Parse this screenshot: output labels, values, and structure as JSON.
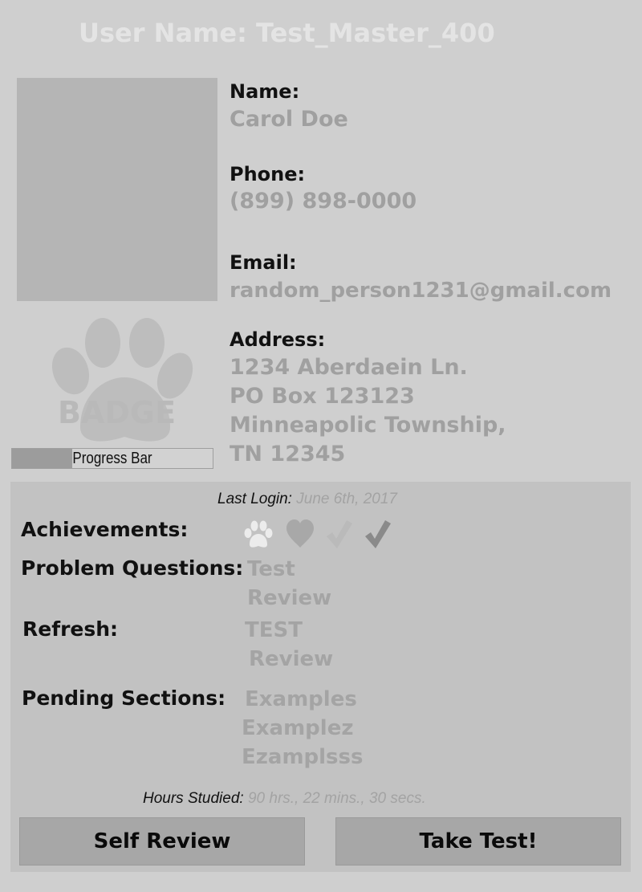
{
  "header": {
    "username_line": "User Name: Test_Master_400"
  },
  "profile": {
    "name_label": "Name:",
    "name_value": "Carol Doe",
    "phone_label": "Phone:",
    "phone_value": "(899) 898-0000",
    "email_label": "Email:",
    "email_value": "random_person1231@gmail.com",
    "address_label": "Address:",
    "address_lines": [
      "1234 Aberdaein Ln.",
      "PO Box 123123",
      "Minneapolic Township,",
      "TN 12345"
    ]
  },
  "badge": {
    "text": "BADGE",
    "icon": "paw-icon",
    "progress_label": "Progress Bar",
    "progress_fraction": 0.3
  },
  "stats": {
    "last_login_label": "Last Login:",
    "last_login_value": "June 6th, 2017",
    "achievements_label": "Achievements:",
    "achievement_icons": [
      "paw-icon",
      "heart-icon",
      "check-icon",
      "check-icon"
    ],
    "problem_questions_label": "Problem Questions:",
    "problem_questions": [
      "Test",
      "Review"
    ],
    "refresh_label": "Refresh:",
    "refresh_items": [
      "TEST",
      "Review"
    ],
    "pending_label": "Pending Sections:",
    "pending_items": [
      "Examples",
      "Examplez",
      "Ezamplsss"
    ],
    "hours_label": "Hours Studied:",
    "hours_value": "90 hrs., 22 mins., 30 secs."
  },
  "actions": {
    "self_review_label": "Self Review",
    "take_test_label": "Take Test!"
  },
  "colors": {
    "background": "#cfcfcf",
    "panel": "#c2c2c2",
    "button": "#a7a7a7",
    "muted_text": "#a0a0a0"
  }
}
